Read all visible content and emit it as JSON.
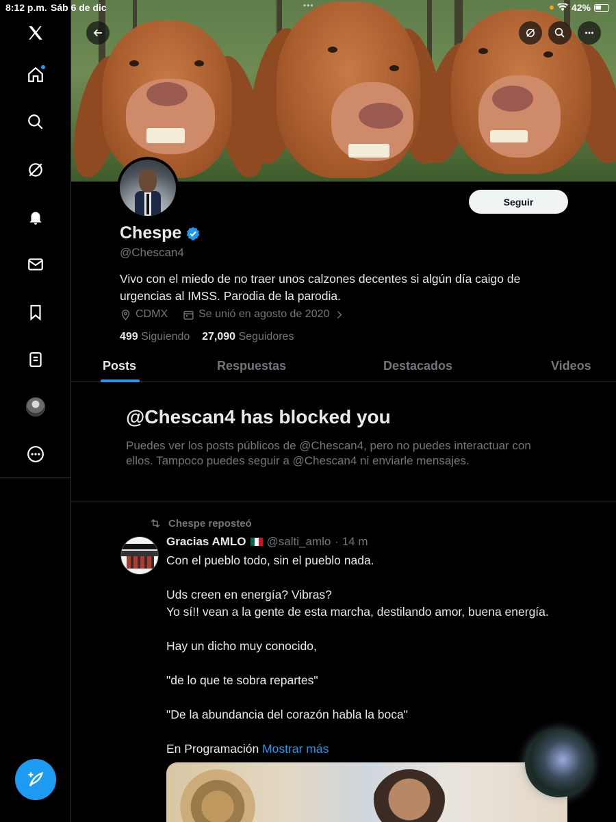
{
  "status_bar": {
    "time": "8:12 p.m.",
    "date": "Sáb 6 de dic",
    "battery": "42%"
  },
  "sidebar": {
    "items": [
      {
        "icon": "x-logo-icon"
      },
      {
        "icon": "home-icon"
      },
      {
        "icon": "search-icon"
      },
      {
        "icon": "grok-icon"
      },
      {
        "icon": "notifications-icon"
      },
      {
        "icon": "messages-icon"
      },
      {
        "icon": "bookmarks-icon"
      },
      {
        "icon": "lists-icon"
      },
      {
        "icon": "profile-avatar"
      },
      {
        "icon": "more-icon"
      }
    ],
    "compose_icon": "compose-post-icon"
  },
  "profile": {
    "name": "Chespe",
    "handle": "@Chescan4",
    "verified": true,
    "follow_label": "Seguir",
    "bio": "Vivo con el miedo de no traer unos calzones decentes si algún día caigo de urgencias al IMSS. Parodia de la parodia.",
    "location": "CDMX",
    "joined": "Se unió en agosto de 2020",
    "following_count": "499",
    "following_label": "Siguiendo",
    "followers_count": "27,090",
    "followers_label": "Seguidores"
  },
  "tabs": [
    {
      "label": "Posts",
      "active": true
    },
    {
      "label": "Respuestas",
      "active": false
    },
    {
      "label": "Destacados",
      "active": false
    },
    {
      "label": "Videos",
      "active": false
    }
  ],
  "blocked": {
    "title": "@Chescan4 has blocked you",
    "description": "Puedes ver los posts públicos de @Chescan4, pero no puedes interactuar con ellos. Tampoco puedes seguir a @Chescan4 ni enviarle mensajes."
  },
  "post": {
    "repost_label": "Chespe reposteó",
    "author_name": "Gracias AMLO",
    "author_handle": "@salti_amlo",
    "time": "· 14 m",
    "lines": [
      "Con el pueblo todo, sin el pueblo nada.",
      "Uds creen en energía? Vibras?",
      "Yo sí!! vean a la gente de esta marcha, destilando amor, buena energía.",
      "Hay un dicho muy conocido,",
      "\"de lo que te sobra repartes\"",
      "\"De la abundancia del corazón habla la boca\"",
      "En Programación"
    ],
    "show_more": "Mostrar más"
  },
  "colors": {
    "accent": "#1d9bf0",
    "background": "#000000",
    "secondary_text": "#71767b"
  }
}
